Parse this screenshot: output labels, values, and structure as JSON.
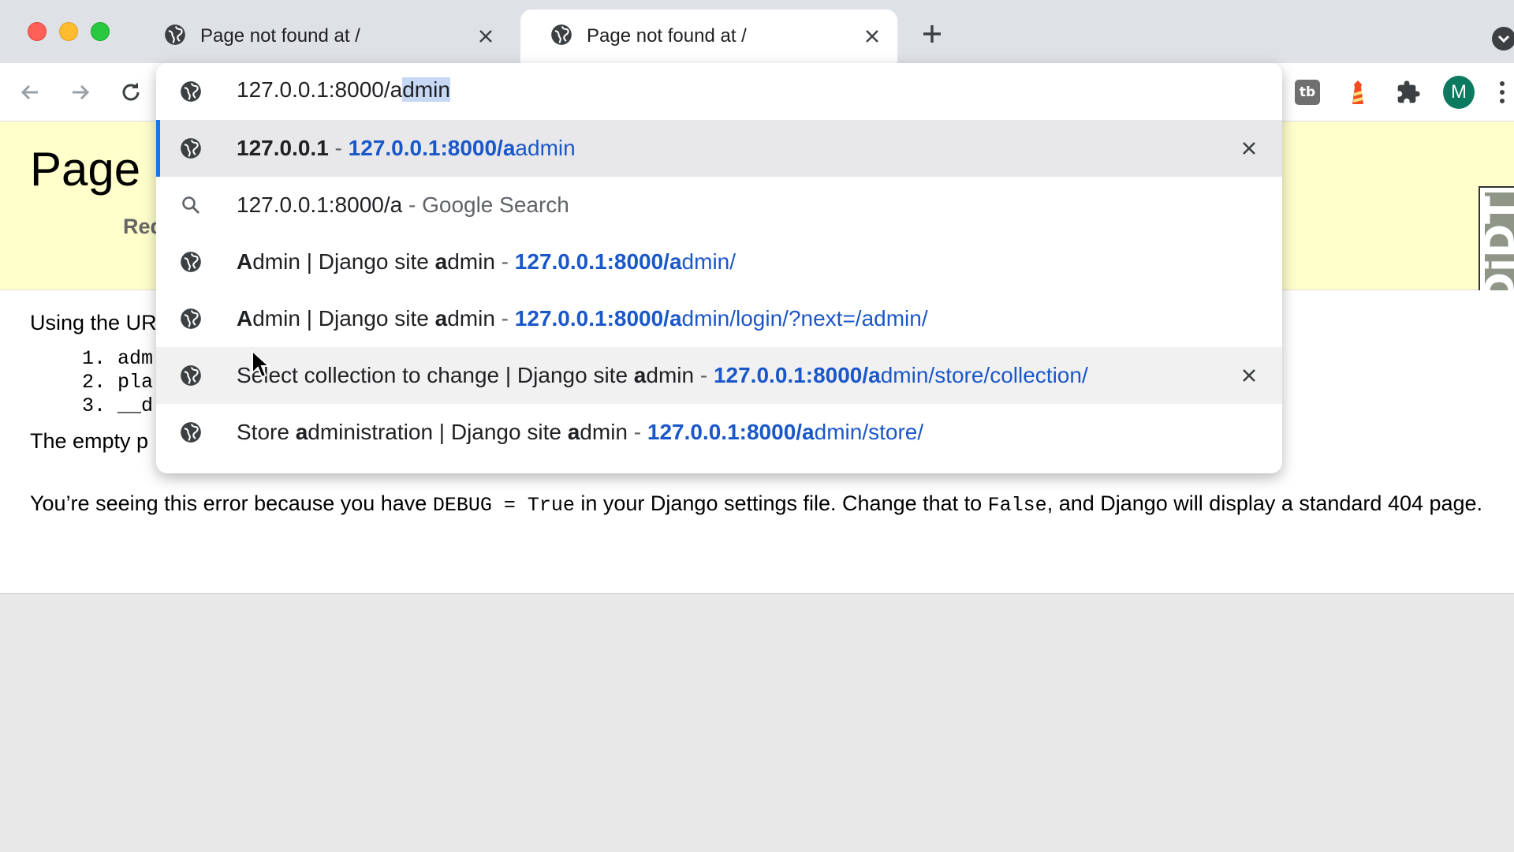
{
  "browser": {
    "tabs": [
      {
        "title": "Page not found at /",
        "active": false
      },
      {
        "title": "Page not found at /",
        "active": true
      }
    ],
    "profile_initial": "M",
    "extensions": [
      "tb-extension-icon",
      "lighthouse-icon",
      "puzzle-icon"
    ]
  },
  "omnibox": {
    "typed_prefix": "127.0.0.1:8000/a",
    "autocomplete_selected": "dmin",
    "suggestions": [
      {
        "icon": "globe-icon",
        "title_bold": "127.0.0.1",
        "dash": " - ",
        "url_bold": "127.0.0.1:8000/a",
        "url_rest": "admin",
        "removable": true,
        "state": "selected"
      },
      {
        "icon": "search-icon",
        "query": "127.0.0.1:8000/a",
        "dash": " - ",
        "engine": "Google Search",
        "state": "normal"
      },
      {
        "icon": "globe-icon",
        "title_bold_a": "A",
        "title_mid": "dmin | Django site ",
        "title_bold_b": "a",
        "title_end": "dmin",
        "dash": " - ",
        "url_bold": "127.0.0.1:8000/a",
        "url_rest": "dmin/",
        "state": "normal"
      },
      {
        "icon": "globe-icon",
        "title_bold_a": "A",
        "title_mid": "dmin | Django site ",
        "title_bold_b": "a",
        "title_end": "dmin",
        "dash": " - ",
        "url_bold": "127.0.0.1:8000/a",
        "url_rest": "dmin/login/?next=/admin/",
        "state": "normal"
      },
      {
        "icon": "globe-icon",
        "title_start": "Select collection to change | Django site ",
        "title_bold": "a",
        "title_end": "dmin",
        "dash": " - ",
        "url_bold": "127.0.0.1:8000/a",
        "url_rest": "dmin/store/collection/",
        "removable": true,
        "state": "hover"
      },
      {
        "icon": "globe-icon",
        "title_start": "Store ",
        "title_bold_a": "a",
        "title_mid": "dministration | Django site ",
        "title_bold_b": "a",
        "title_end": "dmin",
        "dash": " - ",
        "url_bold": "127.0.0.1:8000/a",
        "url_rest": "dmin/store/",
        "state": "normal"
      }
    ]
  },
  "page": {
    "heading_visible": "Page n",
    "request_label_visible": "Req",
    "using_visible": "Using the UR",
    "patterns_visible": [
      "adm",
      "pla",
      "__d"
    ],
    "empty_visible": "The empty p",
    "debug_prefix": "You’re seeing this error because you have ",
    "debug_code": "DEBUG = True",
    "debug_middle": " in your Django settings file. Change that to ",
    "debug_false": "False",
    "debug_suffix": ", and Django will display a standard 404 page.",
    "toolbar_tab_label": "DjDT"
  }
}
